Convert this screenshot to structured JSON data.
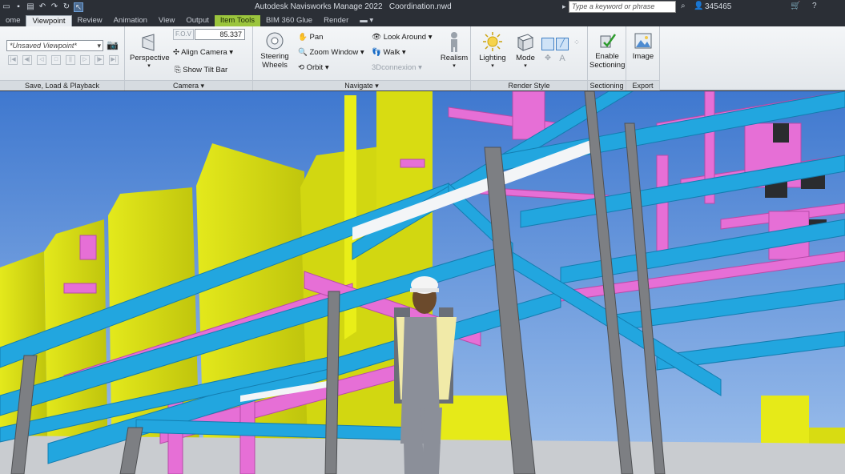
{
  "titlebar": {
    "app_title": "Autodesk Navisworks Manage 2022",
    "file_name": "Coordination.nwd",
    "search_placeholder": "Type a keyword or phrase",
    "user_id": "345465"
  },
  "tabs": [
    {
      "label": "ome"
    },
    {
      "label": "Viewpoint",
      "active": true
    },
    {
      "label": "Review"
    },
    {
      "label": "Animation"
    },
    {
      "label": "View"
    },
    {
      "label": "Output"
    },
    {
      "label": "Item Tools",
      "highlight": true
    },
    {
      "label": "BIM 360 Glue"
    },
    {
      "label": "Render"
    }
  ],
  "ribbon": {
    "save_load": {
      "viewpoint_value": "*Unsaved Viewpoint*",
      "panel_label": "Save, Load & Playback"
    },
    "camera": {
      "perspective_label": "Perspective",
      "fov_label": "F.O.V",
      "fov_value": "85.337",
      "align_camera_label": "Align Camera",
      "show_tilt_bar_label": "Show Tilt Bar",
      "panel_label": "Camera"
    },
    "navigate": {
      "steering_wheels_line1": "Steering",
      "steering_wheels_line2": "Wheels",
      "pan_label": "Pan",
      "zoom_window_label": "Zoom Window",
      "orbit_label": "Orbit",
      "look_around_label": "Look Around",
      "walk_label": "Walk",
      "connexion_label": "3Dconnexion",
      "realism_label": "Realism",
      "panel_label": "Navigate"
    },
    "render_style": {
      "lighting_label": "Lighting",
      "mode_label": "Mode",
      "panel_label": "Render Style"
    },
    "sectioning": {
      "enable_line1": "Enable",
      "enable_line2": "Sectioning",
      "panel_label": "Sectioning"
    },
    "export": {
      "image_label": "Image",
      "panel_label": "Export"
    }
  },
  "colors": {
    "sky": "#4f86d8",
    "wall_yellow": "#d9df14",
    "duct_blue": "#22a6df",
    "pipe_pink": "#e66fd6",
    "column_gray": "#7d7f83"
  }
}
